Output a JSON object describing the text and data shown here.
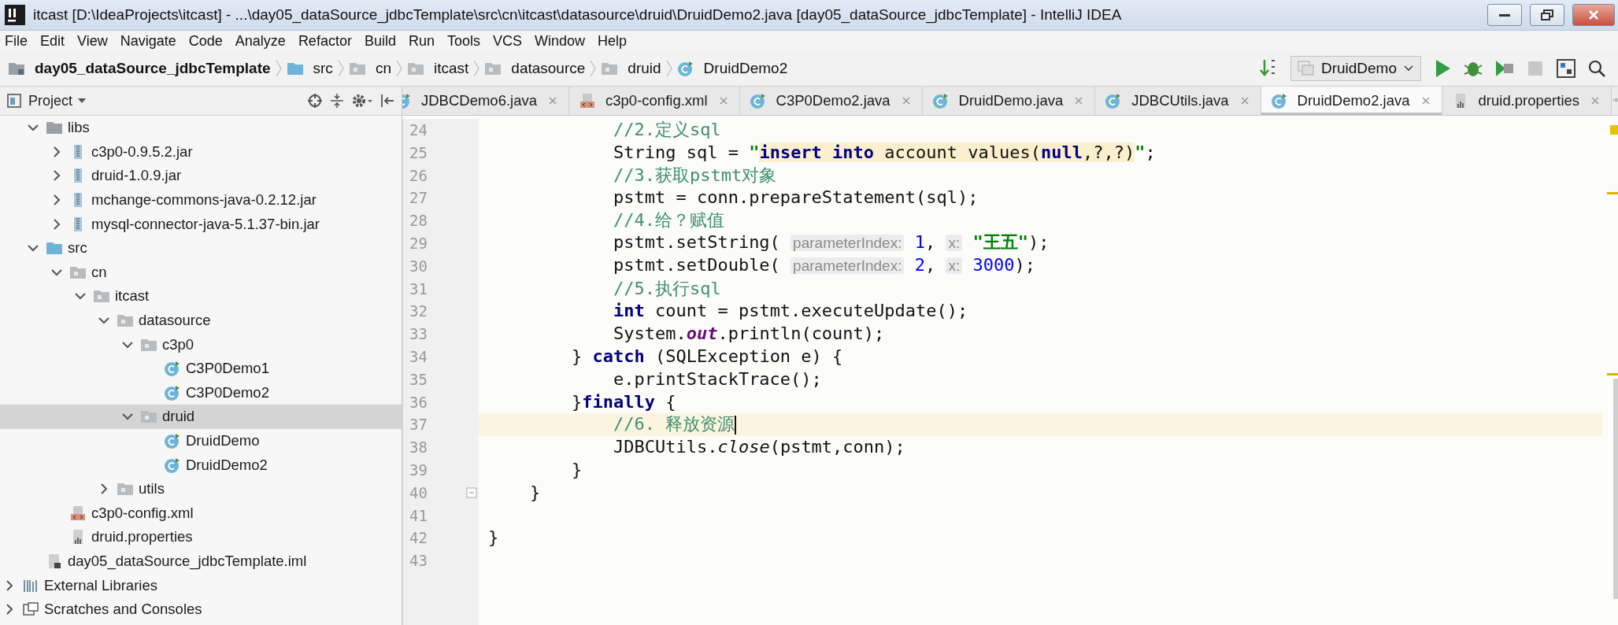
{
  "window": {
    "title": "itcast [D:\\IdeaProjects\\itcast] - ...\\day05_dataSource_jdbcTemplate\\src\\cn\\itcast\\datasource\\druid\\DruidDemo2.java [day05_dataSource_jdbcTemplate] - IntelliJ IDEA"
  },
  "menu": [
    "File",
    "Edit",
    "View",
    "Navigate",
    "Code",
    "Analyze",
    "Refactor",
    "Build",
    "Run",
    "Tools",
    "VCS",
    "Window",
    "Help"
  ],
  "breadcrumb": [
    {
      "label": "day05_dataSource_jdbcTemplate",
      "kind": "module"
    },
    {
      "label": "src",
      "kind": "source"
    },
    {
      "label": "cn",
      "kind": "package"
    },
    {
      "label": "itcast",
      "kind": "package"
    },
    {
      "label": "datasource",
      "kind": "package"
    },
    {
      "label": "druid",
      "kind": "package"
    },
    {
      "label": "DruidDemo2",
      "kind": "class"
    }
  ],
  "run_config": {
    "label": "DruidDemo"
  },
  "project_panel": {
    "title": "Project",
    "project_children": [
      {
        "label": "libs",
        "kind": "folder",
        "expanded": true,
        "selected": false,
        "children": [
          {
            "label": "c3p0-0.9.5.2.jar",
            "kind": "jar",
            "expanded": false,
            "selected": false
          },
          {
            "label": "druid-1.0.9.jar",
            "kind": "jar",
            "expanded": false,
            "selected": false
          },
          {
            "label": "mchange-commons-java-0.2.12.jar",
            "kind": "jar",
            "expanded": false,
            "selected": false
          },
          {
            "label": "mysql-connector-java-5.1.37-bin.jar",
            "kind": "jar",
            "expanded": false,
            "selected": false
          }
        ]
      },
      {
        "label": "src",
        "kind": "source",
        "expanded": true,
        "selected": false,
        "children": [
          {
            "label": "cn",
            "kind": "package",
            "expanded": true,
            "selected": false,
            "children": [
              {
                "label": "itcast",
                "kind": "package",
                "expanded": true,
                "selected": false,
                "children": [
                  {
                    "label": "datasource",
                    "kind": "package",
                    "expanded": true,
                    "selected": false,
                    "children": [
                      {
                        "label": "c3p0",
                        "kind": "package",
                        "expanded": true,
                        "selected": false,
                        "children": [
                          {
                            "label": "C3P0Demo1",
                            "kind": "class",
                            "selected": false
                          },
                          {
                            "label": "C3P0Demo2",
                            "kind": "class",
                            "selected": false
                          }
                        ]
                      },
                      {
                        "label": "druid",
                        "kind": "package",
                        "expanded": true,
                        "selected": true,
                        "children": [
                          {
                            "label": "DruidDemo",
                            "kind": "class",
                            "selected": false
                          },
                          {
                            "label": "DruidDemo2",
                            "kind": "class",
                            "selected": false
                          }
                        ]
                      }
                    ]
                  },
                  {
                    "label": "utils",
                    "kind": "package",
                    "expanded": false,
                    "selected": false
                  }
                ]
              }
            ]
          },
          {
            "label": "c3p0-config.xml",
            "kind": "xml",
            "selected": false
          },
          {
            "label": "druid.properties",
            "kind": "properties",
            "selected": false
          }
        ]
      },
      {
        "label": "day05_dataSource_jdbcTemplate.iml",
        "kind": "iml",
        "selected": false
      }
    ],
    "roots": [
      {
        "label": "External Libraries",
        "kind": "libraries",
        "expanded": false,
        "selected": false
      },
      {
        "label": "Scratches and Consoles",
        "kind": "scratches",
        "expanded": false,
        "selected": false
      }
    ]
  },
  "tabs": [
    {
      "label": "JDBCDemo6.java",
      "kind": "class",
      "selected": false
    },
    {
      "label": "c3p0-config.xml",
      "kind": "xml",
      "selected": false
    },
    {
      "label": "C3P0Demo2.java",
      "kind": "class",
      "selected": false
    },
    {
      "label": "DruidDemo.java",
      "kind": "class",
      "selected": false
    },
    {
      "label": "JDBCUtils.java",
      "kind": "class",
      "selected": false
    },
    {
      "label": "DruidDemo2.java",
      "kind": "class",
      "selected": true
    },
    {
      "label": "druid.properties",
      "kind": "properties",
      "selected": false
    }
  ],
  "editor": {
    "lines": [
      {
        "number": "24",
        "current": false,
        "tokens": [
          {
            "text": "            //2.定义sql",
            "kind": "comment"
          }
        ]
      },
      {
        "number": "25",
        "current": false,
        "tokens": [
          {
            "text": "            String sql = ",
            "kind": "plain"
          },
          {
            "text": "\"",
            "kind": "string"
          },
          {
            "text": "insert into",
            "kind": "sql_keyword"
          },
          {
            "text": " account values(",
            "kind": "sql"
          },
          {
            "text": "null",
            "kind": "sql_keyword"
          },
          {
            "text": ",?,?)",
            "kind": "sql"
          },
          {
            "text": "\"",
            "kind": "string"
          },
          {
            "text": ";",
            "kind": "plain"
          }
        ]
      },
      {
        "number": "26",
        "current": false,
        "tokens": [
          {
            "text": "            //3.获取pstmt对象",
            "kind": "comment"
          }
        ]
      },
      {
        "number": "27",
        "current": false,
        "tokens": [
          {
            "text": "            pstmt = conn.prepareStatement(sql);",
            "kind": "plain"
          }
        ]
      },
      {
        "number": "28",
        "current": false,
        "tokens": [
          {
            "text": "            //4.给？赋值",
            "kind": "comment"
          }
        ]
      },
      {
        "number": "29",
        "current": false,
        "tokens": [
          {
            "text": "            pstmt.setString( ",
            "kind": "plain"
          },
          {
            "text": "parameterIndex:",
            "kind": "hint"
          },
          {
            "text": " 1",
            "kind": "number"
          },
          {
            "text": ", ",
            "kind": "plain"
          },
          {
            "text": "x:",
            "kind": "hint"
          },
          {
            "text": " \"王五\"",
            "kind": "string"
          },
          {
            "text": ");",
            "kind": "plain"
          }
        ]
      },
      {
        "number": "30",
        "current": false,
        "tokens": [
          {
            "text": "            pstmt.setDouble( ",
            "kind": "plain"
          },
          {
            "text": "parameterIndex:",
            "kind": "hint"
          },
          {
            "text": " 2",
            "kind": "number"
          },
          {
            "text": ", ",
            "kind": "plain"
          },
          {
            "text": "x:",
            "kind": "hint"
          },
          {
            "text": " 3000",
            "kind": "number"
          },
          {
            "text": ");",
            "kind": "plain"
          }
        ]
      },
      {
        "number": "31",
        "current": false,
        "tokens": [
          {
            "text": "            //5.执行sql",
            "kind": "comment"
          }
        ]
      },
      {
        "number": "32",
        "current": false,
        "tokens": [
          {
            "text": "            int",
            "kind": "keyword"
          },
          {
            "text": " count = pstmt.executeUpdate();",
            "kind": "plain"
          }
        ]
      },
      {
        "number": "33",
        "current": false,
        "tokens": [
          {
            "text": "            System.",
            "kind": "plain"
          },
          {
            "text": "out",
            "kind": "static_field"
          },
          {
            "text": ".println(count);",
            "kind": "plain"
          }
        ]
      },
      {
        "number": "34",
        "current": false,
        "tokens": [
          {
            "text": "        } ",
            "kind": "plain"
          },
          {
            "text": "catch",
            "kind": "keyword"
          },
          {
            "text": " (SQLException e) {",
            "kind": "plain"
          }
        ]
      },
      {
        "number": "35",
        "current": false,
        "tokens": [
          {
            "text": "            e.printStackTrace();",
            "kind": "plain"
          }
        ]
      },
      {
        "number": "36",
        "current": false,
        "tokens": [
          {
            "text": "        }",
            "kind": "plain"
          },
          {
            "text": "finally",
            "kind": "keyword"
          },
          {
            "text": " {",
            "kind": "plain"
          }
        ]
      },
      {
        "number": "37",
        "current": true,
        "tokens": [
          {
            "text": "            //6. 释放资源",
            "kind": "comment"
          }
        ]
      },
      {
        "number": "38",
        "current": false,
        "tokens": [
          {
            "text": "            JDBCUtils.",
            "kind": "plain"
          },
          {
            "text": "close",
            "kind": "italic"
          },
          {
            "text": "(pstmt,conn);",
            "kind": "plain"
          }
        ]
      },
      {
        "number": "39",
        "current": false,
        "tokens": [
          {
            "text": "        }",
            "kind": "plain"
          }
        ]
      },
      {
        "number": "40",
        "current": false,
        "tokens": [
          {
            "text": "    }",
            "kind": "plain"
          }
        ]
      },
      {
        "number": "41",
        "current": false
      },
      {
        "number": "42",
        "current": false,
        "tokens": [
          {
            "text": "}",
            "kind": "plain"
          }
        ]
      },
      {
        "number": "43",
        "current": false
      }
    ]
  }
}
